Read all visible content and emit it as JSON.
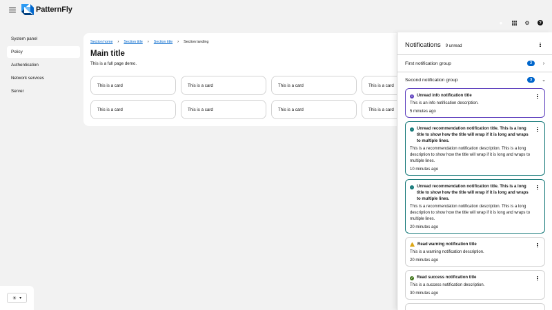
{
  "masthead": {
    "brand": "PatternFly",
    "tools": [
      {
        "name": "notification-bell-icon",
        "glyph": "●"
      },
      {
        "name": "app-grid-icon",
        "glyph": "▦"
      },
      {
        "name": "gear-icon",
        "glyph": "⚙"
      },
      {
        "name": "help-icon",
        "glyph": "?"
      }
    ]
  },
  "sidebar": {
    "items": [
      {
        "label": "System panel",
        "active": false
      },
      {
        "label": "Policy",
        "active": true
      },
      {
        "label": "Authentication",
        "active": false
      },
      {
        "label": "Network services",
        "active": false
      },
      {
        "label": "Server",
        "active": false
      }
    ],
    "theme_icon": "☀",
    "theme_caret": "▾"
  },
  "main": {
    "breadcrumb": [
      "Section home",
      "Section title",
      "Section title"
    ],
    "breadcrumb_current": "Section landing",
    "title": "Main title",
    "description": "This is a full page demo.",
    "cards": [
      "This is a card",
      "This is a card",
      "This is a card",
      "This is a card",
      "This is a card",
      "This is a card",
      "This is a card",
      "This is a card"
    ]
  },
  "drawer": {
    "title": "Notifications",
    "unread": "9 unread",
    "groups": [
      {
        "title": "First notification group",
        "count": "2",
        "expanded": false
      },
      {
        "title": "Second notification group",
        "count": "3",
        "expanded": true
      }
    ],
    "notifications": [
      {
        "variant": "info",
        "read": false,
        "title": "Unread info notification title",
        "description": "This is an info notification description.",
        "time": "5 minutes ago"
      },
      {
        "variant": "reco",
        "read": false,
        "title": "Unread recommendation notification title. This is a long title to show how the title will wrap if it is long and wraps to multiple lines.",
        "description": "This is a recommendation notification description. This is a long description to show how the title will wrap if it is long and wraps to multiple lines.",
        "time": "10 minutes ago"
      },
      {
        "variant": "reco",
        "read": false,
        "title": "Unread recommendation notification title. This is a long title to show how the title will wrap if it is long and wraps to multiple lines.",
        "description": "This is a recommendation notification description. This is a long description to show how the title will wrap if it is long and wraps to multiple lines.",
        "time": "20 minutes ago"
      },
      {
        "variant": "warning",
        "read": true,
        "title": "Read warning notification title",
        "description": "This is a warning notification description.",
        "time": "20 minutes ago"
      },
      {
        "variant": "success",
        "read": true,
        "title": "Read success notification title",
        "description": "This is a success notification description.",
        "time": "30 minutes ago"
      }
    ]
  },
  "colors": {
    "info": "#5e40be",
    "recommendation": "#147878",
    "warning": "#dca614",
    "success": "#3d7317",
    "link": "#0066cc",
    "badge": "#0066cc"
  }
}
